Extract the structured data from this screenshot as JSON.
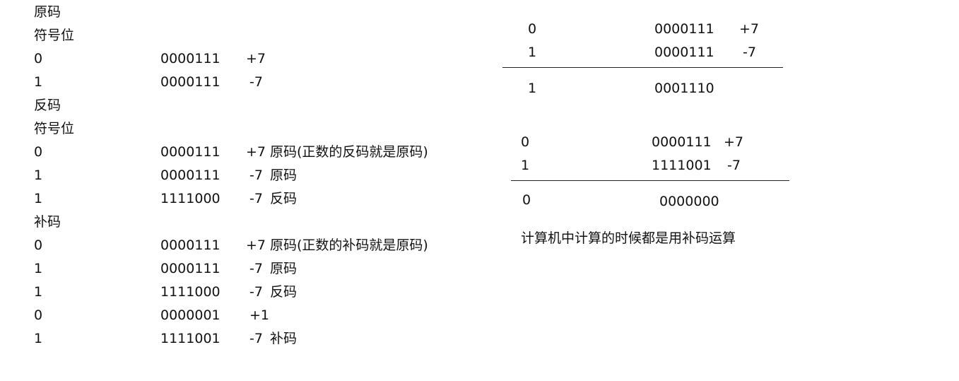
{
  "left": {
    "yuanma": {
      "title": "原码",
      "sign_label": "符号位",
      "rows": [
        {
          "sign": "0",
          "bits": "0000111",
          "value": "+7",
          "note": ""
        },
        {
          "sign": "1",
          "bits": "0000111",
          "value": "-7",
          "note": ""
        }
      ]
    },
    "fanma": {
      "title": "反码",
      "sign_label": "符号位",
      "rows": [
        {
          "sign": "0",
          "bits": "0000111",
          "value": "+7",
          "note": "原码(正数的反码就是原码)"
        },
        {
          "sign": "1",
          "bits": "0000111",
          "value": "-7",
          "note": "原码"
        },
        {
          "sign": "1",
          "bits": "1111000",
          "value": "-7",
          "note": "反码"
        }
      ]
    },
    "buma": {
      "title": "补码",
      "rows": [
        {
          "sign": "0",
          "bits": "0000111",
          "value": "+7",
          "note": "原码(正数的补码就是原码)"
        },
        {
          "sign": "1",
          "bits": "0000111",
          "value": "-7",
          "note": "原码"
        },
        {
          "sign": "1",
          "bits": "1111000",
          "value": "-7",
          "note": "反码"
        },
        {
          "sign": "0",
          "bits": "0000001",
          "value": "+1",
          "note": ""
        },
        {
          "sign": "1",
          "bits": "1111001",
          "value": "-7",
          "note": "补码"
        }
      ]
    }
  },
  "right": {
    "sum_original": {
      "rows": [
        {
          "sign": "0",
          "bits": "0000111",
          "value": "+7"
        },
        {
          "sign": "1",
          "bits": "0000111",
          "value": "-7"
        }
      ],
      "result": {
        "sign": "1",
        "bits": "0001110"
      }
    },
    "sum_complement": {
      "rows": [
        {
          "sign": "0",
          "bits": "0000111",
          "value": "+7"
        },
        {
          "sign": "1",
          "bits": "1111001",
          "value": "-7"
        }
      ],
      "result": {
        "sign": "0",
        "bits": "0000000"
      }
    },
    "conclusion": "计算机中计算的时候都是用补码运算"
  }
}
